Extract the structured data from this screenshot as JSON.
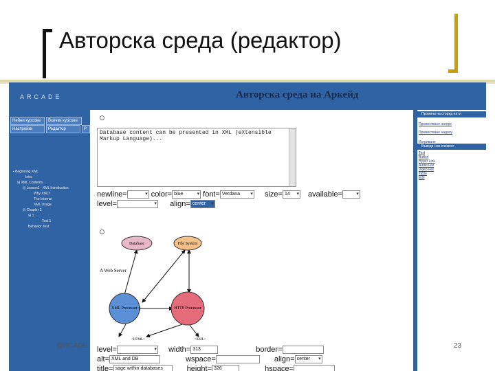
{
  "slide": {
    "title": "Авторска среда (редактор)",
    "footer_left": "@RCADE",
    "page_number": "23"
  },
  "app": {
    "logo": "ARCADE",
    "banner": "Авторска среда на Аркейд",
    "accent_color": "#2f63a4"
  },
  "leftnav": {
    "buttons": [
      "Нейни курсове",
      "Всички курсове",
      "Настройки",
      "Редактор",
      "Р"
    ],
    "tree": [
      "Beginning XML",
      "Intro",
      "XML Contents",
      "Lesson1 - XML Introduction",
      "Why XML?",
      "The Internet",
      "XML Usage",
      "Chapter 2",
      "1",
      "Test 1",
      "Behavior Test"
    ]
  },
  "main": {
    "textarea_value": "Database content can be presented in XML (eXtensible\nMarkup Language)...",
    "text_form": {
      "newline_label": "newline=",
      "color_label": "color=",
      "color_value": "blue",
      "font_label": "font=",
      "font_value": "Verdana",
      "size_label": "size=",
      "size_value": "14",
      "available_label": "available=",
      "level_label": "level=",
      "align_label": "align=",
      "align_value": "center"
    },
    "diagram": {
      "database": "Database",
      "filesystem": "File System",
      "webserver": "A Web Server",
      "xml": "XML Processor",
      "http": "HTTP Processor",
      "html_tag": "<HTML>",
      "xml_tag": "<XML>"
    },
    "image_form": {
      "level_label": "level=",
      "width_label": "width=",
      "width_value": "313",
      "border_label": "border=",
      "alt_label": "alt=",
      "alt_value": "XML and DB",
      "wspace_label": "wspace=",
      "align_label": "align=",
      "align_value": "center",
      "title_label": "title=",
      "title_value": "sage within databases",
      "height_label": "height=",
      "height_value": "326",
      "hspace_label": "hspace="
    }
  },
  "rightnav": {
    "title1": "Промяна на сторид на от",
    "links1": [
      "Преместване нагоре",
      "Преместване надолу",
      "Изтриване"
    ],
    "title2": "Въведи нов елемент",
    "links2": [
      "Text",
      "Button",
      "Hyper Link",
      "Audio File",
      "Video File",
      "Table",
      "Edit"
    ]
  }
}
